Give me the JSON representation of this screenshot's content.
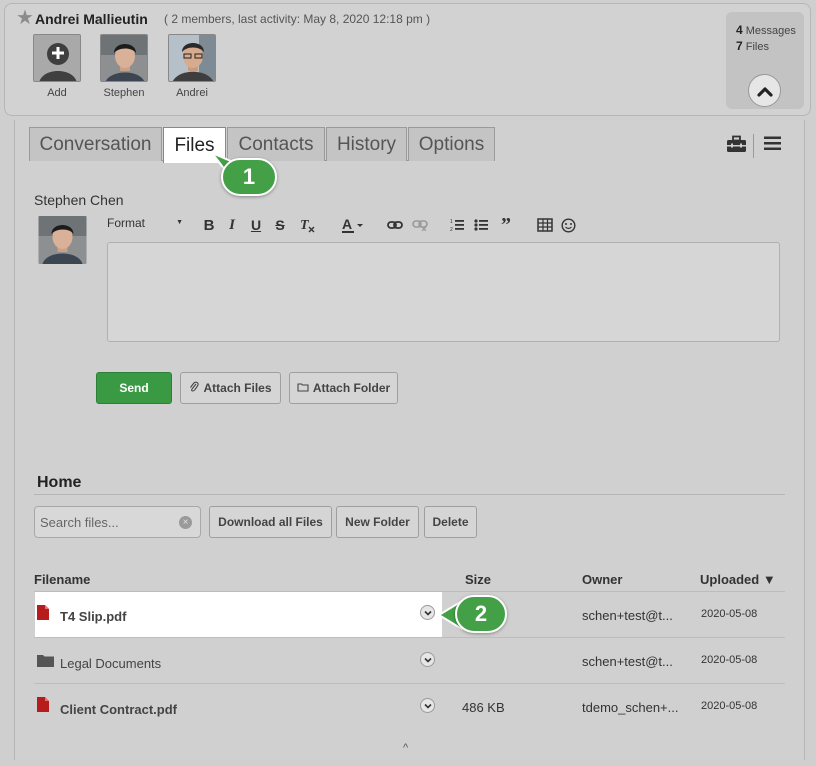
{
  "conversation": {
    "title": "Andrei Mallieutin",
    "meta": "( 2 members, last activity: May 8, 2020 12:18 pm )",
    "members": [
      {
        "name": "Add"
      },
      {
        "name": "Stephen"
      },
      {
        "name": "Andrei"
      }
    ],
    "stats": {
      "messages_count": "4",
      "messages_label": "Messages",
      "files_count": "7",
      "files_label": "Files"
    }
  },
  "tabs": [
    {
      "label": "Conversation"
    },
    {
      "label": "Files"
    },
    {
      "label": "Contacts"
    },
    {
      "label": "History"
    },
    {
      "label": "Options"
    }
  ],
  "callouts": [
    "1",
    "2"
  ],
  "composer": {
    "author": "Stephen Chen",
    "format_label": "Format",
    "send_label": "Send",
    "attach_files_label": "Attach Files",
    "attach_folder_label": "Attach Folder"
  },
  "files": {
    "section_title": "Home",
    "search_placeholder": "Search files...",
    "download_all_label": "Download all Files",
    "new_folder_label": "New Folder",
    "delete_label": "Delete",
    "columns": {
      "filename": "Filename",
      "size": "Size",
      "owner": "Owner",
      "uploaded": "Uploaded ▼"
    },
    "rows": [
      {
        "name": "T4 Slip.pdf",
        "size": "",
        "owner": "schen+test@t...",
        "uploaded": "2020-05-08"
      },
      {
        "name": "Legal Documents",
        "size": "",
        "owner": "schen+test@t...",
        "uploaded": "2020-05-08"
      },
      {
        "name": "Client Contract.pdf",
        "size": "486 KB",
        "owner": "tdemo_schen+...",
        "uploaded": "2020-05-08"
      }
    ]
  },
  "colors": {
    "accent_green": "#43a047",
    "send_green": "#3a9a44",
    "pdf_red": "#b71c1c",
    "folder_gray": "#555555"
  },
  "icons": {
    "favorite": "star-icon",
    "add_member": "add-user-icon",
    "collapse": "chevron-up-icon",
    "toolbox": "briefcase-icon",
    "menu": "hamburger-menu-icon",
    "pdf": "pdf-file-icon",
    "folder": "folder-icon",
    "row_menu": "chevron-down-icon",
    "clear": "clear-icon"
  }
}
